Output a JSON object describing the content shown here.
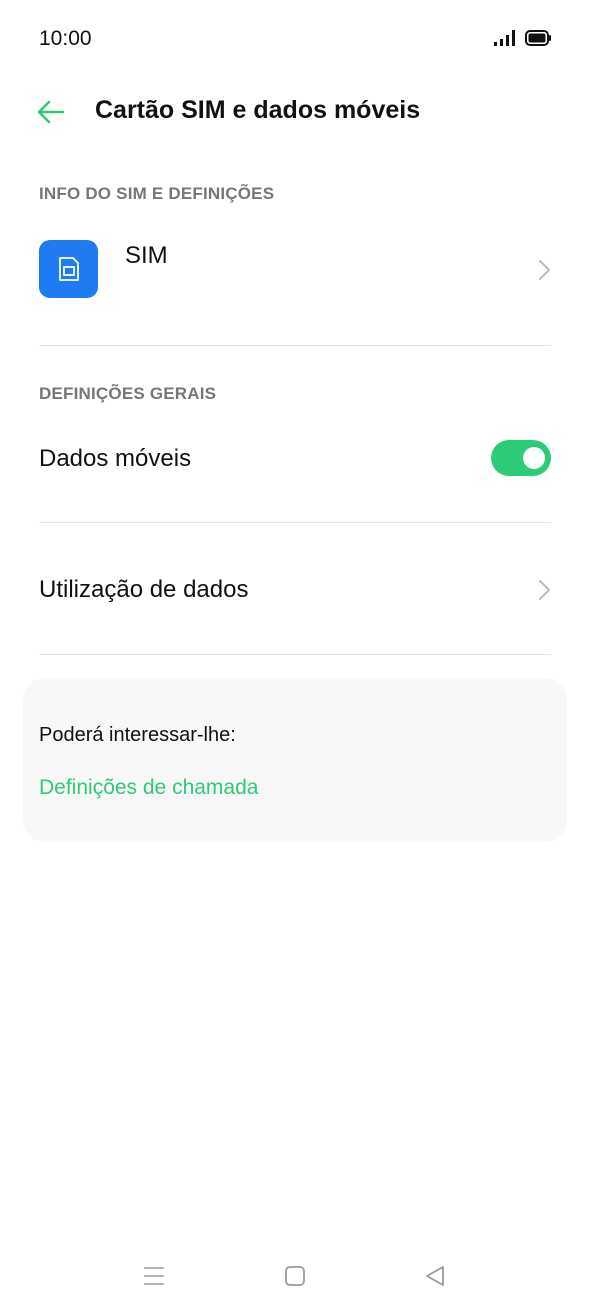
{
  "status_bar": {
    "time": "10:00",
    "icons": [
      "signal-icon",
      "battery-icon"
    ]
  },
  "header": {
    "back_icon": "back-arrow-icon",
    "title": "Cartão SIM e dados móveis"
  },
  "sections": {
    "sim_info": {
      "header": "INFO DO SIM E DEFINIÇÕES",
      "sim_item": {
        "label": "SIM",
        "icon": "sim-card-icon"
      }
    },
    "general": {
      "header": "DEFINIÇÕES GERAIS",
      "mobile_data": {
        "label": "Dados móveis",
        "enabled": true
      },
      "data_usage": {
        "label": "Utilização de dados"
      }
    }
  },
  "suggestions": {
    "title": "Poderá interessar-lhe:",
    "link": "Definições de chamada"
  },
  "nav_bar": {
    "icons": [
      "menu-icon",
      "home-icon",
      "back-icon"
    ]
  },
  "colors": {
    "accent": "#2DCB78",
    "sim_tile": "#1E7BF2",
    "section_header": "#777777",
    "card_bg": "#F8F8F8"
  }
}
